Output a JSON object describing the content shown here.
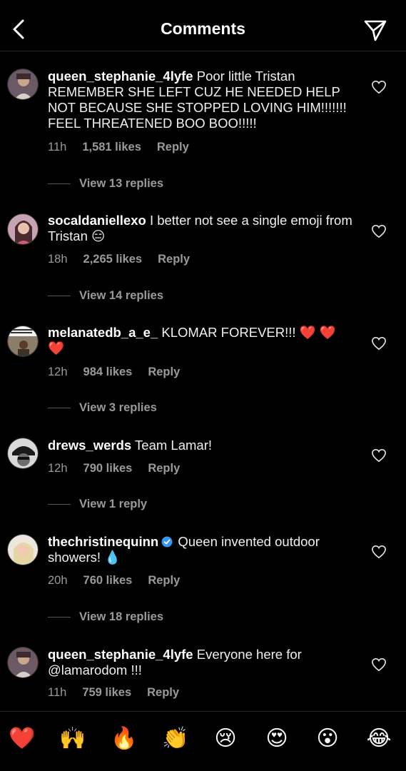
{
  "header": {
    "title": "Comments"
  },
  "comments": [
    {
      "username": "queen_stephanie_4lyfe",
      "text": "Poor little Tristan REMEMBER SHE LEFT CUZ HE NEEDED HELP NOT BECAUSE SHE STOPPED LOVING HIM!!!!!!! FEEL THREATENED BOO BOO!!!!!",
      "time": "11h",
      "likes": "1,581 likes",
      "reply": "Reply",
      "view_replies": "View 13 replies"
    },
    {
      "username": "socaldaniellexo",
      "text": "I better not see a single emoji from Tristan 😑",
      "time": "18h",
      "likes": "2,265 likes",
      "reply": "Reply",
      "view_replies": "View 14 replies"
    },
    {
      "username": "melanatedb_a_e_",
      "text": "KLOMAR FOREVER!!! ❤️ ❤️ ❤️",
      "time": "12h",
      "likes": "984 likes",
      "reply": "Reply",
      "view_replies": "View 3 replies"
    },
    {
      "username": "drews_werds",
      "text": "Team Lamar!",
      "time": "12h",
      "likes": "790 likes",
      "reply": "Reply",
      "view_replies": "View 1 reply"
    },
    {
      "username": "thechristinequinn",
      "text": "Queen invented outdoor showers! 💧",
      "time": "20h",
      "likes": "760 likes",
      "reply": "Reply",
      "view_replies": "View 18 replies"
    },
    {
      "username": "queen_stephanie_4lyfe",
      "text": "Everyone here for @lamarodom !!!",
      "time": "11h",
      "likes": "759 likes",
      "reply": "Reply"
    }
  ],
  "emoji_bar": [
    "❤️",
    "🙌",
    "🔥",
    "👏",
    "😢",
    "😍",
    "😮",
    "😂"
  ],
  "colors": {
    "background": "#000000",
    "text": "#f5f5f5",
    "muted": "#9a9a9a",
    "verified": "#3897f0"
  }
}
